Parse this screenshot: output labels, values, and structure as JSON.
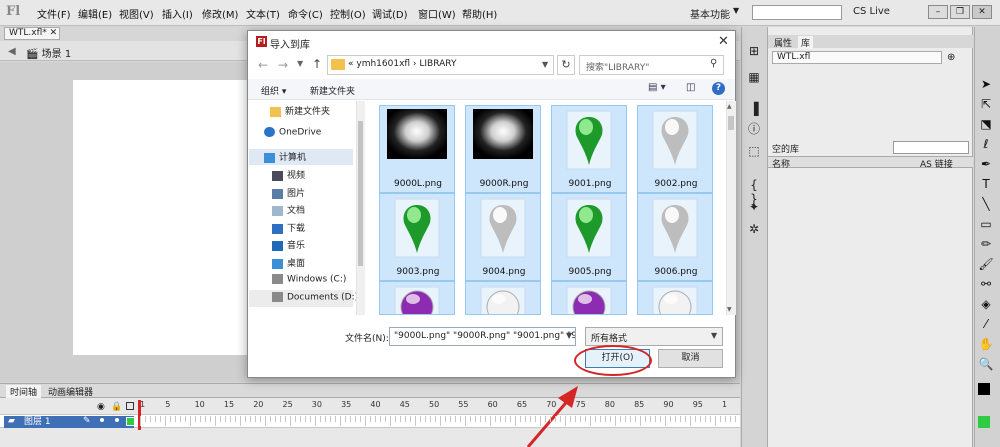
{
  "menubar": {
    "items": [
      "文件(F)",
      "编辑(E)",
      "视图(V)",
      "插入(I)",
      "修改(M)",
      "文本(T)",
      "命令(C)",
      "控制(O)",
      "调试(D)",
      "窗口(W)",
      "帮助(H)"
    ],
    "workspace": "基本功能",
    "cs_live": "CS Live"
  },
  "document": {
    "tab_label": "WTL.xfl*",
    "scene_label": "场景 1"
  },
  "timeline": {
    "tabs": [
      "时间轴",
      "动画编辑器"
    ],
    "frame_numbers": [
      "1",
      "5",
      "10",
      "15",
      "20",
      "25",
      "30",
      "35",
      "40",
      "45",
      "50",
      "55",
      "60",
      "65",
      "70",
      "75",
      "80",
      "85",
      "90",
      "95",
      "1"
    ],
    "layer_name": "图层 1"
  },
  "library_panel": {
    "tabs": [
      "属性",
      "库"
    ],
    "file": "WTL.xfl",
    "empty_label": "空的库",
    "col_name": "名称",
    "col_link": "AS 链接"
  },
  "dialog": {
    "title": "导入到库",
    "address": "« ymh1601xfl › LIBRARY",
    "search_placeholder": "搜索\"LIBRARY\"",
    "organize": "组织 ▾",
    "new_folder": "新建文件夹",
    "help": "?",
    "tree": [
      {
        "label": "新建文件夹",
        "icon": "folder"
      },
      {
        "label": "OneDrive",
        "icon": "cloud"
      },
      {
        "label": "计算机",
        "icon": "computer"
      },
      {
        "label": "视频",
        "icon": "video"
      },
      {
        "label": "图片",
        "icon": "picture"
      },
      {
        "label": "文档",
        "icon": "document"
      },
      {
        "label": "下载",
        "icon": "download"
      },
      {
        "label": "音乐",
        "icon": "music"
      },
      {
        "label": "桌面",
        "icon": "desktop"
      },
      {
        "label": "Windows (C:)",
        "icon": "drive"
      },
      {
        "label": "Documents (D:)",
        "icon": "drive"
      }
    ],
    "files": [
      {
        "name": "9000L.png",
        "kind": "glow"
      },
      {
        "name": "9000R.png",
        "kind": "glow"
      },
      {
        "name": "9001.png",
        "kind": "green-pin"
      },
      {
        "name": "9002.png",
        "kind": "white-pin"
      },
      {
        "name": "9003.png",
        "kind": "green-pin"
      },
      {
        "name": "9004.png",
        "kind": "white-pin"
      },
      {
        "name": "9005.png",
        "kind": "green-pin"
      },
      {
        "name": "9006.png",
        "kind": "white-pin"
      },
      {
        "name": "",
        "kind": "purple-ball"
      },
      {
        "name": "",
        "kind": "white-ball"
      },
      {
        "name": "",
        "kind": "purple-ball"
      },
      {
        "name": "",
        "kind": "white-ball"
      }
    ],
    "filename_label": "文件名(N):",
    "filename_value": "\"9000L.png\" \"9000R.png\" \"9001.png\" \"9",
    "filetype": "所有格式",
    "open_label": "打开(O)",
    "cancel_label": "取消"
  },
  "colors": {
    "highlight": "#d62525",
    "tile_selected": "#cde6fb"
  }
}
